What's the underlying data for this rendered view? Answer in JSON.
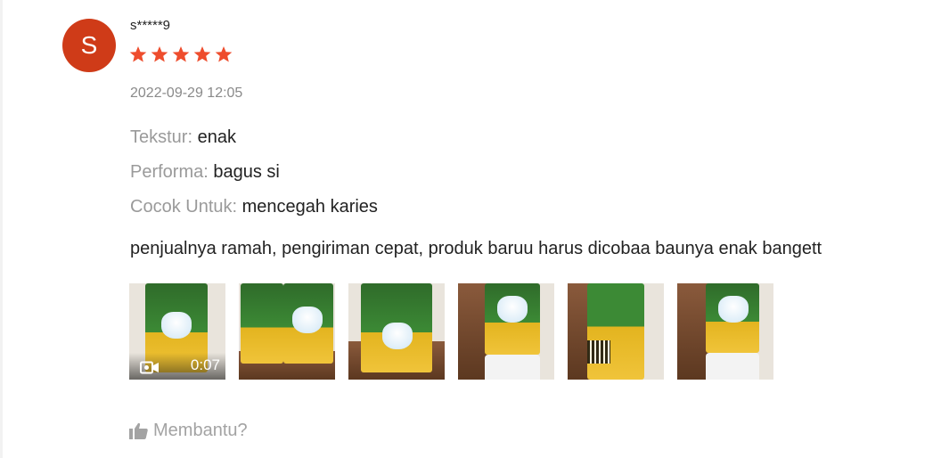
{
  "review": {
    "avatar_letter": "S",
    "avatar_color": "#cf3b18",
    "username": "s*****9",
    "rating": 5,
    "star_color": "#ee4d2d",
    "timestamp": "2022-09-29 12:05",
    "attributes": [
      {
        "label": "Tekstur:",
        "value": "enak"
      },
      {
        "label": "Performa:",
        "value": "bagus si"
      },
      {
        "label": "Cocok Untuk:",
        "value": "mencegah karies"
      }
    ],
    "comment": "penjualnya ramah, pengiriman cepat, produk baruu harus dicobaa baunya enak bangett",
    "media": {
      "video_duration": "0:07",
      "video_icon": "video-camera-icon"
    },
    "helpful_label": "Membantu?",
    "helpful_icon": "thumbs-up-icon"
  }
}
